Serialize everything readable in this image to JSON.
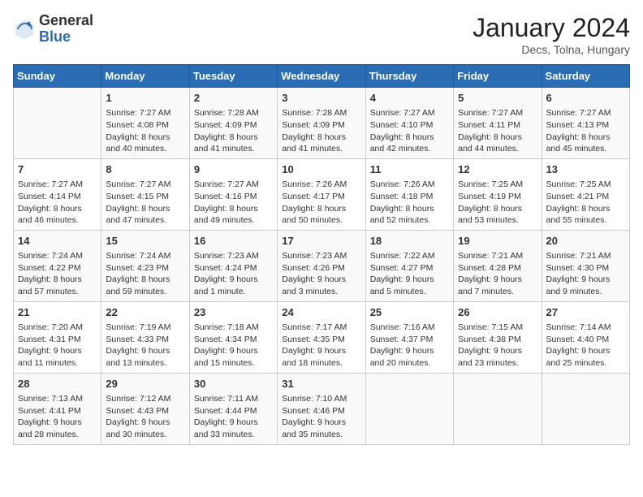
{
  "logo": {
    "general": "General",
    "blue": "Blue"
  },
  "title": "January 2024",
  "subtitle": "Decs, Tolna, Hungary",
  "days_of_week": [
    "Sunday",
    "Monday",
    "Tuesday",
    "Wednesday",
    "Thursday",
    "Friday",
    "Saturday"
  ],
  "weeks": [
    [
      {
        "day": "",
        "sunrise": "",
        "sunset": "",
        "daylight": ""
      },
      {
        "day": "1",
        "sunrise": "Sunrise: 7:27 AM",
        "sunset": "Sunset: 4:08 PM",
        "daylight": "Daylight: 8 hours and 40 minutes."
      },
      {
        "day": "2",
        "sunrise": "Sunrise: 7:28 AM",
        "sunset": "Sunset: 4:09 PM",
        "daylight": "Daylight: 8 hours and 41 minutes."
      },
      {
        "day": "3",
        "sunrise": "Sunrise: 7:28 AM",
        "sunset": "Sunset: 4:09 PM",
        "daylight": "Daylight: 8 hours and 41 minutes."
      },
      {
        "day": "4",
        "sunrise": "Sunrise: 7:27 AM",
        "sunset": "Sunset: 4:10 PM",
        "daylight": "Daylight: 8 hours and 42 minutes."
      },
      {
        "day": "5",
        "sunrise": "Sunrise: 7:27 AM",
        "sunset": "Sunset: 4:11 PM",
        "daylight": "Daylight: 8 hours and 44 minutes."
      },
      {
        "day": "6",
        "sunrise": "Sunrise: 7:27 AM",
        "sunset": "Sunset: 4:13 PM",
        "daylight": "Daylight: 8 hours and 45 minutes."
      }
    ],
    [
      {
        "day": "7",
        "sunrise": "Sunrise: 7:27 AM",
        "sunset": "Sunset: 4:14 PM",
        "daylight": "Daylight: 8 hours and 46 minutes."
      },
      {
        "day": "8",
        "sunrise": "Sunrise: 7:27 AM",
        "sunset": "Sunset: 4:15 PM",
        "daylight": "Daylight: 8 hours and 47 minutes."
      },
      {
        "day": "9",
        "sunrise": "Sunrise: 7:27 AM",
        "sunset": "Sunset: 4:16 PM",
        "daylight": "Daylight: 8 hours and 49 minutes."
      },
      {
        "day": "10",
        "sunrise": "Sunrise: 7:26 AM",
        "sunset": "Sunset: 4:17 PM",
        "daylight": "Daylight: 8 hours and 50 minutes."
      },
      {
        "day": "11",
        "sunrise": "Sunrise: 7:26 AM",
        "sunset": "Sunset: 4:18 PM",
        "daylight": "Daylight: 8 hours and 52 minutes."
      },
      {
        "day": "12",
        "sunrise": "Sunrise: 7:25 AM",
        "sunset": "Sunset: 4:19 PM",
        "daylight": "Daylight: 8 hours and 53 minutes."
      },
      {
        "day": "13",
        "sunrise": "Sunrise: 7:25 AM",
        "sunset": "Sunset: 4:21 PM",
        "daylight": "Daylight: 8 hours and 55 minutes."
      }
    ],
    [
      {
        "day": "14",
        "sunrise": "Sunrise: 7:24 AM",
        "sunset": "Sunset: 4:22 PM",
        "daylight": "Daylight: 8 hours and 57 minutes."
      },
      {
        "day": "15",
        "sunrise": "Sunrise: 7:24 AM",
        "sunset": "Sunset: 4:23 PM",
        "daylight": "Daylight: 8 hours and 59 minutes."
      },
      {
        "day": "16",
        "sunrise": "Sunrise: 7:23 AM",
        "sunset": "Sunset: 4:24 PM",
        "daylight": "Daylight: 9 hours and 1 minute."
      },
      {
        "day": "17",
        "sunrise": "Sunrise: 7:23 AM",
        "sunset": "Sunset: 4:26 PM",
        "daylight": "Daylight: 9 hours and 3 minutes."
      },
      {
        "day": "18",
        "sunrise": "Sunrise: 7:22 AM",
        "sunset": "Sunset: 4:27 PM",
        "daylight": "Daylight: 9 hours and 5 minutes."
      },
      {
        "day": "19",
        "sunrise": "Sunrise: 7:21 AM",
        "sunset": "Sunset: 4:28 PM",
        "daylight": "Daylight: 9 hours and 7 minutes."
      },
      {
        "day": "20",
        "sunrise": "Sunrise: 7:21 AM",
        "sunset": "Sunset: 4:30 PM",
        "daylight": "Daylight: 9 hours and 9 minutes."
      }
    ],
    [
      {
        "day": "21",
        "sunrise": "Sunrise: 7:20 AM",
        "sunset": "Sunset: 4:31 PM",
        "daylight": "Daylight: 9 hours and 11 minutes."
      },
      {
        "day": "22",
        "sunrise": "Sunrise: 7:19 AM",
        "sunset": "Sunset: 4:33 PM",
        "daylight": "Daylight: 9 hours and 13 minutes."
      },
      {
        "day": "23",
        "sunrise": "Sunrise: 7:18 AM",
        "sunset": "Sunset: 4:34 PM",
        "daylight": "Daylight: 9 hours and 15 minutes."
      },
      {
        "day": "24",
        "sunrise": "Sunrise: 7:17 AM",
        "sunset": "Sunset: 4:35 PM",
        "daylight": "Daylight: 9 hours and 18 minutes."
      },
      {
        "day": "25",
        "sunrise": "Sunrise: 7:16 AM",
        "sunset": "Sunset: 4:37 PM",
        "daylight": "Daylight: 9 hours and 20 minutes."
      },
      {
        "day": "26",
        "sunrise": "Sunrise: 7:15 AM",
        "sunset": "Sunset: 4:38 PM",
        "daylight": "Daylight: 9 hours and 23 minutes."
      },
      {
        "day": "27",
        "sunrise": "Sunrise: 7:14 AM",
        "sunset": "Sunset: 4:40 PM",
        "daylight": "Daylight: 9 hours and 25 minutes."
      }
    ],
    [
      {
        "day": "28",
        "sunrise": "Sunrise: 7:13 AM",
        "sunset": "Sunset: 4:41 PM",
        "daylight": "Daylight: 9 hours and 28 minutes."
      },
      {
        "day": "29",
        "sunrise": "Sunrise: 7:12 AM",
        "sunset": "Sunset: 4:43 PM",
        "daylight": "Daylight: 9 hours and 30 minutes."
      },
      {
        "day": "30",
        "sunrise": "Sunrise: 7:11 AM",
        "sunset": "Sunset: 4:44 PM",
        "daylight": "Daylight: 9 hours and 33 minutes."
      },
      {
        "day": "31",
        "sunrise": "Sunrise: 7:10 AM",
        "sunset": "Sunset: 4:46 PM",
        "daylight": "Daylight: 9 hours and 35 minutes."
      },
      {
        "day": "",
        "sunrise": "",
        "sunset": "",
        "daylight": ""
      },
      {
        "day": "",
        "sunrise": "",
        "sunset": "",
        "daylight": ""
      },
      {
        "day": "",
        "sunrise": "",
        "sunset": "",
        "daylight": ""
      }
    ]
  ]
}
